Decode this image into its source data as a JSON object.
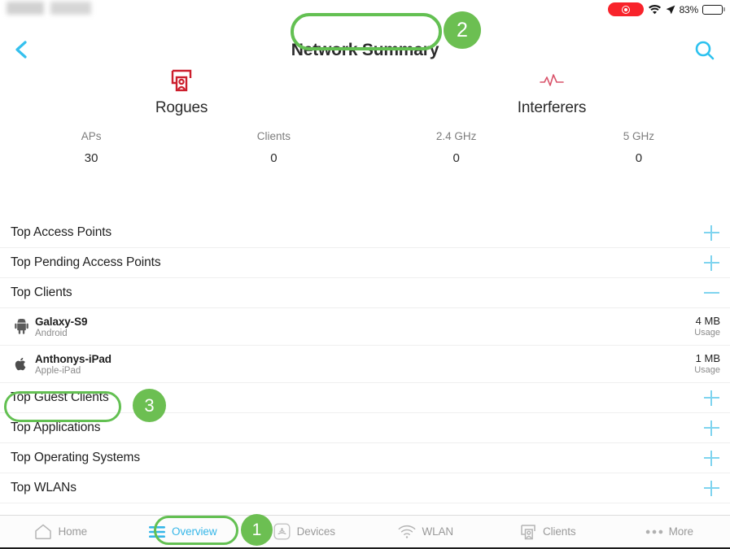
{
  "status_bar": {
    "carrier_redacted": "",
    "recording_icon": "record-indicator-icon",
    "wifi_icon": "wifi-icon",
    "location_icon": "location-arrow-icon",
    "battery_percent": "83%",
    "battery_icon": "battery-icon"
  },
  "navbar": {
    "back_icon": "back-chevron-icon",
    "title": "Network Summary",
    "search_icon": "search-icon"
  },
  "cards": [
    {
      "label": "Rogues",
      "icon": "rogue-device-icon",
      "color": "#cc1f2d"
    },
    {
      "label": "Interferers",
      "icon": "interference-waveform-icon",
      "color": "#d9536a"
    }
  ],
  "stats": [
    {
      "name": "APs",
      "value": "30"
    },
    {
      "name": "Clients",
      "value": "0"
    },
    {
      "name": "2.4 GHz",
      "value": "0"
    },
    {
      "name": "5 GHz",
      "value": "0"
    }
  ],
  "list": {
    "rows": [
      {
        "label": "Top Access Points",
        "action": "plus",
        "action_icon": "plus-icon"
      },
      {
        "label": "Top Pending Access Points",
        "action": "plus",
        "action_icon": "plus-icon"
      },
      {
        "label": "Top Clients",
        "action": "minus",
        "action_icon": "minus-icon"
      }
    ],
    "clients": [
      {
        "name": "Galaxy-S9",
        "os": "Android",
        "icon": "android-icon",
        "usage_value": "4 MB",
        "usage_caption": "Usage"
      },
      {
        "name": "Anthonys-iPad",
        "os": "Apple-iPad",
        "icon": "apple-icon",
        "usage_value": "1 MB",
        "usage_caption": "Usage"
      }
    ],
    "rows_after": [
      {
        "label": "Top Guest Clients",
        "action": "plus",
        "action_icon": "plus-icon"
      },
      {
        "label": "Top Applications",
        "action": "plus",
        "action_icon": "plus-icon"
      },
      {
        "label": "Top Operating Systems",
        "action": "plus",
        "action_icon": "plus-icon"
      },
      {
        "label": "Top WLANs",
        "action": "plus",
        "action_icon": "plus-icon"
      }
    ]
  },
  "tabbar": {
    "tabs": [
      {
        "label": "Home",
        "icon": "home-icon",
        "active": false
      },
      {
        "label": "Overview",
        "icon": "hamburger-menu-icon",
        "active": true
      },
      {
        "label": "Devices",
        "icon": "devices-icon",
        "active": false
      },
      {
        "label": "WLAN",
        "icon": "wifi-icon",
        "active": false
      },
      {
        "label": "Clients",
        "icon": "clients-icon",
        "active": false
      },
      {
        "label": "More",
        "icon": "more-dots-icon",
        "active": false
      }
    ]
  },
  "annotations": {
    "color": "#63c052",
    "badge_color": "#6cbf52",
    "items": [
      {
        "number": "1",
        "target": "Overview"
      },
      {
        "number": "2",
        "target": "Network Summary"
      },
      {
        "number": "3",
        "target": "Top Guest Clients"
      }
    ]
  },
  "colors": {
    "accent_blue": "#35b6e8",
    "plus_blue": "#7fd4ef",
    "annotation_green": "#63c052",
    "rogue_red": "#cc1f2d",
    "text_primary": "#1f1f1f",
    "text_secondary": "#8b8b8b"
  }
}
